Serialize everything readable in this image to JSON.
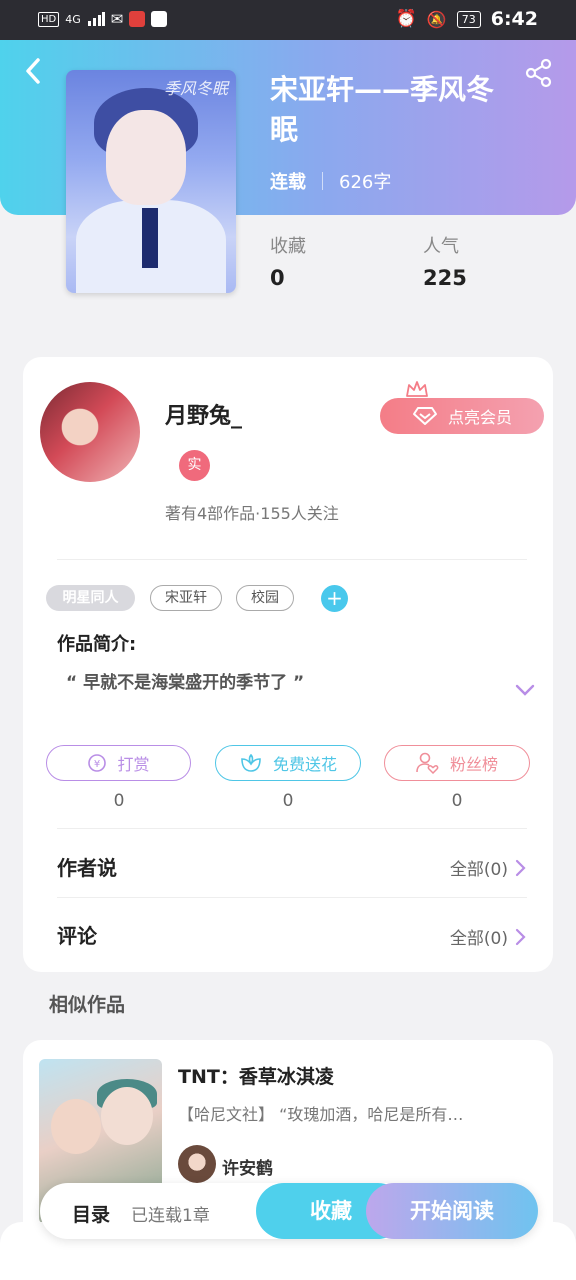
{
  "status_bar": {
    "left_labels": [
      "HD",
      "4G"
    ],
    "battery": "73",
    "time": "6:42"
  },
  "book": {
    "title": "宋亚轩——季风冬眠",
    "cover_text": "季风冬眠",
    "status": "连载",
    "word_count": "626字",
    "stats": {
      "favorites_label": "收藏",
      "favorites_value": "0",
      "popularity_label": "人气",
      "popularity_value": "225"
    }
  },
  "author": {
    "name": "月野兔_",
    "badge": "实",
    "summary": "著有4部作品·155人关注",
    "vip_label": "点亮会员"
  },
  "tags": [
    "明星同人",
    "宋亚轩",
    "校园"
  ],
  "tag_add": "+",
  "intro": {
    "heading": "作品简介:",
    "text": "“ 早就不是海棠盛开的季节了 ”"
  },
  "actions": [
    {
      "label": "打赏",
      "icon": "yen-coin-icon",
      "count": "0",
      "color": "#b98ee6"
    },
    {
      "label": "免费送花",
      "icon": "flower-icon",
      "count": "0",
      "color": "#4fc6e6"
    },
    {
      "label": "粉丝榜",
      "icon": "user-heart-icon",
      "count": "0",
      "color": "#f08f9a"
    }
  ],
  "sections": {
    "author_says": {
      "title": "作者说",
      "link": "全部(0)"
    },
    "comments": {
      "title": "评论",
      "link": "全部(0)"
    }
  },
  "similar": {
    "heading": "相似作品",
    "items": [
      {
        "title": "TNT：香草冰淇凌",
        "desc": "【哈尼文社】 “玫瑰加酒，哈尼是所有…",
        "author": "许安鹤"
      }
    ]
  },
  "bottom_bar": {
    "toc": "目录",
    "chapters": "已连载1章",
    "collect": "收藏",
    "read": "开始阅读"
  },
  "colors": {
    "hero_start": "#4fd2ec",
    "hero_end": "#b59aea",
    "accent_blue": "#4fd0ec",
    "vip_pink": "#f47d87"
  }
}
